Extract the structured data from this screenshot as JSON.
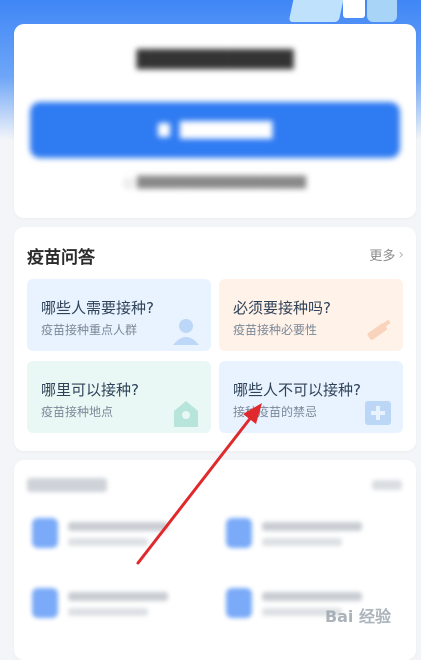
{
  "qa": {
    "title": "疫苗问答",
    "more_label": "更多",
    "tiles": [
      {
        "title": "哪些人需要接种?",
        "subtitle": "疫苗接种重点人群"
      },
      {
        "title": "必须要接种吗?",
        "subtitle": "疫苗接种必要性"
      },
      {
        "title": "哪里可以接种?",
        "subtitle": "疫苗接种地点"
      },
      {
        "title": "哪些人不可以接种?",
        "subtitle": "接种疫苗的禁忌"
      }
    ]
  },
  "watermark": {
    "text": "Bai 经验"
  },
  "colors": {
    "primary_blue": "#2f7bf2",
    "annotation_arrow": "#e0292c"
  },
  "icons": {
    "more": "chevron-right-icon",
    "tile_1": "person-icon",
    "tile_2": "syringe-icon",
    "tile_3": "location-icon",
    "tile_4": "medical-plus-icon"
  }
}
